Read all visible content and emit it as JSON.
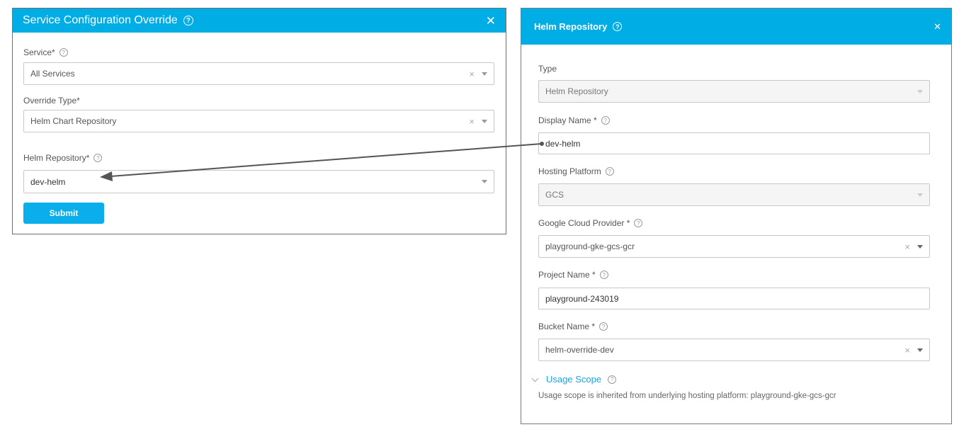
{
  "left_dialog": {
    "title": "Service Configuration Override",
    "close_icon": "close-icon",
    "service_label": "Service*",
    "service_value": "All Services",
    "override_type_label": "Override Type*",
    "override_type_value": "Helm Chart Repository",
    "helm_repository_label": "Helm Repository*",
    "helm_repository_value": "dev-helm",
    "submit_label": "Submit"
  },
  "right_dialog": {
    "title": "Helm Repository",
    "close_icon": "close-icon",
    "type_label": "Type",
    "type_value": "Helm Repository",
    "display_name_label": "Display Name *",
    "display_name_value": "dev-helm",
    "hosting_platform_label": "Hosting Platform",
    "hosting_platform_value": "GCS",
    "google_cloud_provider_label": "Google Cloud Provider *",
    "google_cloud_provider_value": "playground-gke-gcs-gcr",
    "project_name_label": "Project Name *",
    "project_name_value": "playground-243019",
    "bucket_name_label": "Bucket Name *",
    "bucket_name_value": "helm-override-dev",
    "usage_scope_label": "Usage Scope",
    "usage_scope_note": "Usage scope is inherited from underlying hosting platform: playground-gke-gcs-gcr"
  },
  "glyphs": {
    "help": "?",
    "clear": "×",
    "close": "✕"
  },
  "colors": {
    "header": "#00ade4",
    "submit": "#0aaeea",
    "link": "#1aa4e6",
    "arrow": "#555555"
  }
}
